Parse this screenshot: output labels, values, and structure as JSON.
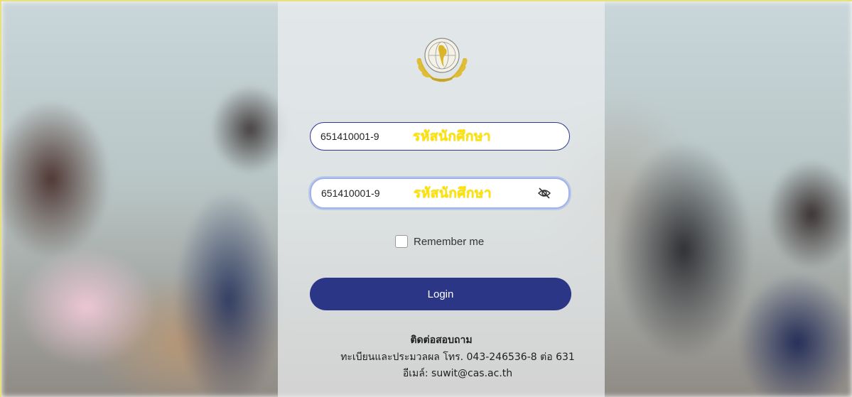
{
  "login_form": {
    "student_id": {
      "value": "651410001-9",
      "overlay_label": "รหัสนักศึกษา"
    },
    "password": {
      "value": "651410001-9",
      "overlay_label": "รหัสนักศึกษา",
      "toggle_icon": "eye-slash-icon"
    },
    "remember_label": "Remember me",
    "login_label": "Login"
  },
  "logo": {
    "icon": "college-seal-logo"
  },
  "contact": {
    "title": "ติดต่อสอบถาม",
    "line1": "ทะเบียนและประมวลผล โทร. 043-246536-8 ต่อ 631",
    "line2": "อีเมล์: suwit@cas.ac.th"
  },
  "colors": {
    "accent": "#2b3686",
    "hint_text": "#ffe500",
    "logo_gold": "#d9b52a"
  }
}
